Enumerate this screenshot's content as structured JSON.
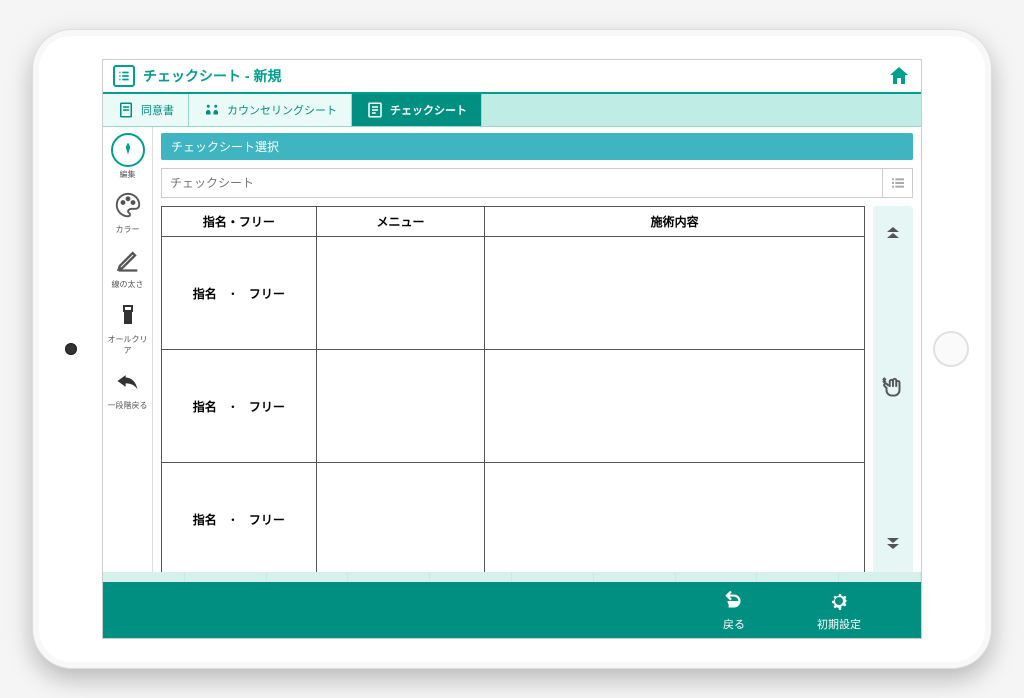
{
  "header": {
    "title": "チェックシート - 新規"
  },
  "tabs": [
    {
      "label": "同意書"
    },
    {
      "label": "カウンセリングシート"
    },
    {
      "label": "チェックシート"
    }
  ],
  "ltool": [
    {
      "label": "編集"
    },
    {
      "label": "カラー"
    },
    {
      "label": "線の太さ"
    },
    {
      "label": "オールクリア"
    },
    {
      "label": "一段階戻る"
    }
  ],
  "section_title": "チェックシート選択",
  "select_placeholder": "チェックシート",
  "columns": {
    "c1": "指名・フリー",
    "c2": "メニュー",
    "c3": "施術内容"
  },
  "row_cell": {
    "a": "指名",
    "sep": "・",
    "b": "フリー"
  },
  "footer": {
    "back": "戻る",
    "settings": "初期設定"
  }
}
